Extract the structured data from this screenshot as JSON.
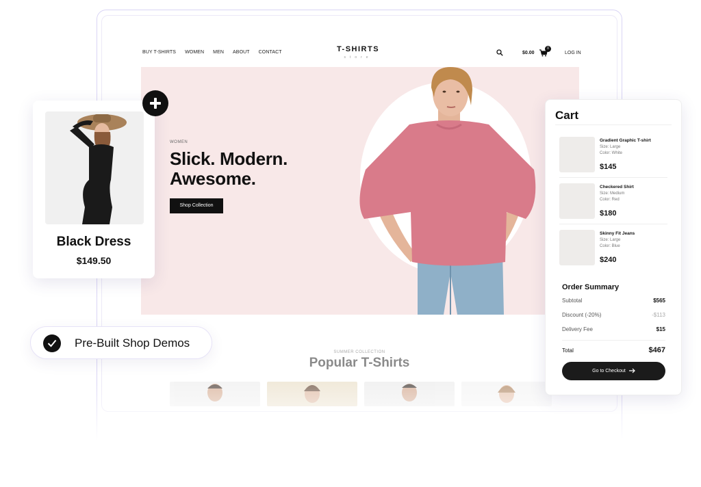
{
  "nav": {
    "links": [
      "BUY T-SHIRTS",
      "WOMEN",
      "MEN",
      "ABOUT",
      "CONTACT"
    ],
    "logo_title": "T-SHIRTS",
    "logo_subtitle": "store",
    "cart_total": "$0.00",
    "cart_count": "0",
    "login_label": "LOG IN",
    "icons": [
      "search-icon",
      "cart-icon"
    ]
  },
  "hero": {
    "tag": "WOMEN",
    "title_line1": "Slick. Modern.",
    "title_line2": "Awesome.",
    "button_label": "Shop Collection"
  },
  "popular": {
    "tag": "SUMMER COLLECTION",
    "title": "Popular T-Shirts"
  },
  "product_card": {
    "name": "Black Dress",
    "price": "$149.50"
  },
  "pill": {
    "label": "Pre-Built Shop Demos"
  },
  "cart": {
    "title": "Cart",
    "items": [
      {
        "name": "Gradient Graphic T-shirt",
        "size": "Size: Large",
        "color": "Color: White",
        "price": "$145"
      },
      {
        "name": "Checkered Shirt",
        "size": "Size: Medium",
        "color": "Color: Red",
        "price": "$180"
      },
      {
        "name": "Skinny Fit Jeans",
        "size": "Size: Large",
        "color": "Color: Blue",
        "price": "$240"
      }
    ],
    "summary": {
      "title": "Order Summary",
      "subtotal_label": "Subtotal",
      "subtotal_value": "$565",
      "discount_label": "Discount (-20%)",
      "discount_value": "-$113",
      "delivery_label": "Delivery Fee",
      "delivery_value": "$15",
      "total_label": "Total",
      "total_value": "$467"
    },
    "checkout_label": "Go to Checkout"
  },
  "colors": {
    "hero_bg": "#f8e8e8",
    "accent_dark": "#111111",
    "frame_border": "#d9d4f5"
  }
}
